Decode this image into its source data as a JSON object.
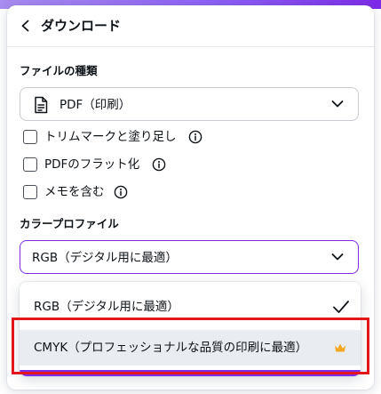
{
  "header": {
    "title": "ダウンロード",
    "back_icon": "chevron-left-icon"
  },
  "file_type": {
    "label": "ファイルの種類",
    "selected": "PDF（印刷）",
    "icon": "document-icon"
  },
  "options": [
    {
      "label": "トリムマークと塗り足し",
      "checked": false,
      "info_icon": "info-icon"
    },
    {
      "label": "PDFのフラット化",
      "checked": false,
      "info_icon": "info-icon"
    },
    {
      "label": "メモを含む",
      "checked": false,
      "info_icon": "info-icon"
    }
  ],
  "color_profile": {
    "label": "カラープロファイル",
    "selected": "RGB（デジタル用に最適）",
    "items": [
      {
        "label": "RGB（デジタル用に最適）",
        "selected": true
      },
      {
        "label": "CMYK（プロフェッショナルな品質の印刷に最適）",
        "selected": false,
        "premium": true,
        "highlighted": true
      }
    ]
  },
  "colors": {
    "accent": "#7d2ae8",
    "premium_crown": "#f5a623",
    "annotation_box": "#e3171b"
  }
}
